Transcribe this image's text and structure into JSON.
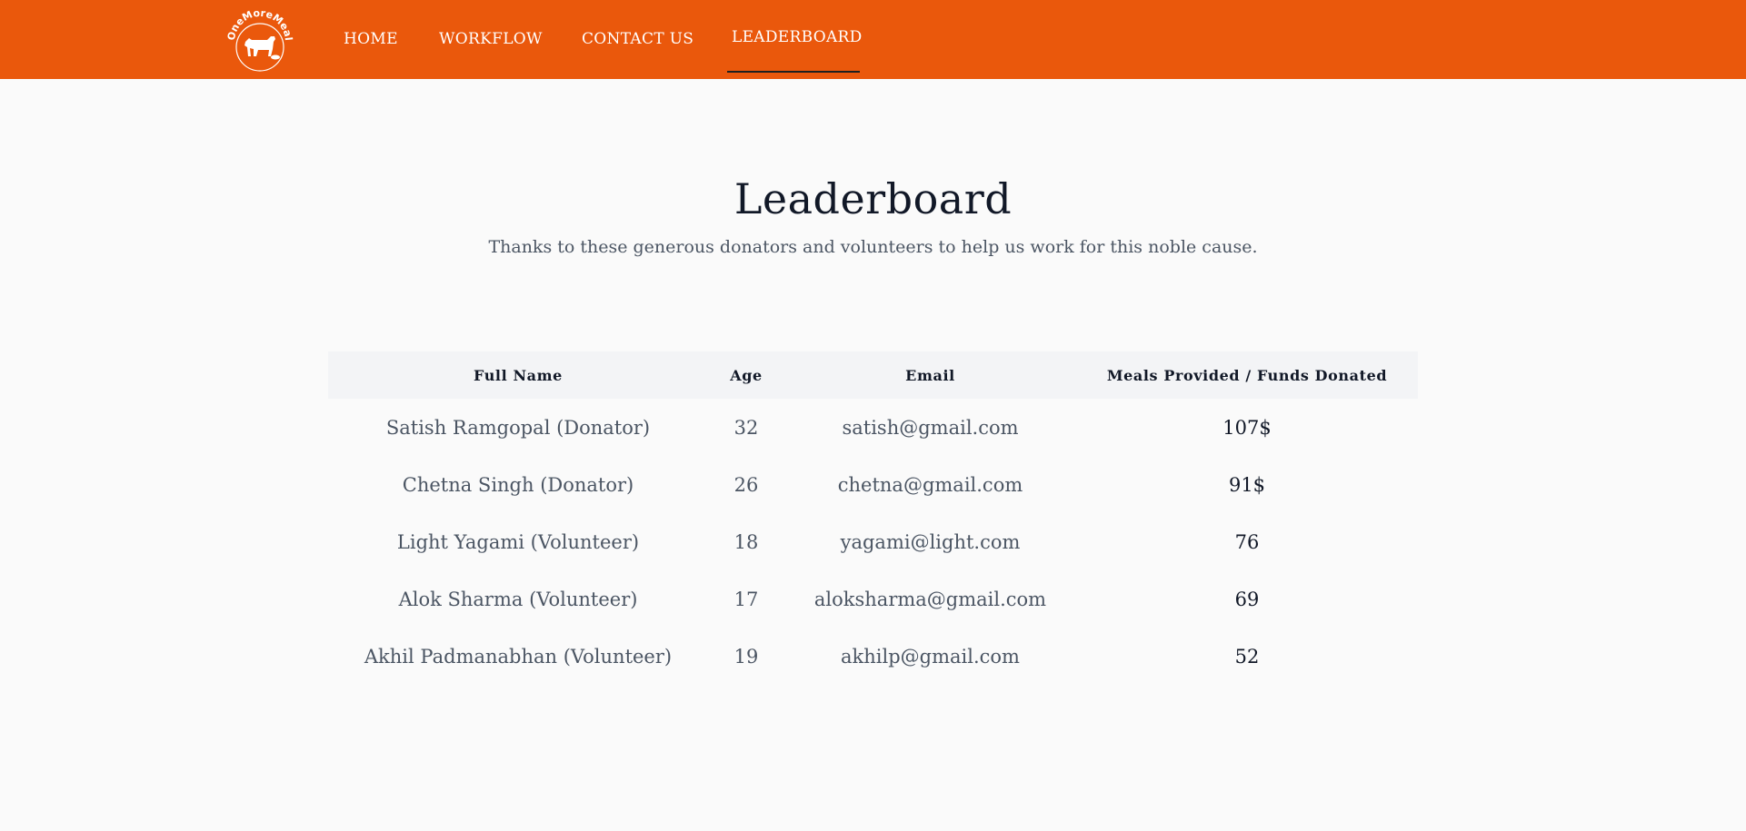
{
  "nav": {
    "logo_alt": "OneMoreMeal",
    "links": [
      {
        "label": "HOME"
      },
      {
        "label": "WORKFLOW"
      },
      {
        "label": "CONTACT US"
      },
      {
        "label": "LEADERBOARD",
        "active": true
      }
    ]
  },
  "header": {
    "title": "Leaderboard",
    "subtitle": "Thanks to these generous donators and volunteers to help us work for this noble cause."
  },
  "table": {
    "columns": [
      "Full Name",
      "Age",
      "Email",
      "Meals Provided / Funds Donated"
    ],
    "rows": [
      {
        "name": "Satish Ramgopal (Donator)",
        "age": "32",
        "email": "satish@gmail.com",
        "meals": "107$"
      },
      {
        "name": "Chetna Singh (Donator)",
        "age": "26",
        "email": "chetna@gmail.com",
        "meals": "91$"
      },
      {
        "name": "Light Yagami (Volunteer)",
        "age": "18",
        "email": "yagami@light.com",
        "meals": "76"
      },
      {
        "name": "Alok Sharma (Volunteer)",
        "age": "17",
        "email": "aloksharma@gmail.com",
        "meals": "69"
      },
      {
        "name": "Akhil Padmanabhan (Volunteer)",
        "age": "19",
        "email": "akhilp@gmail.com",
        "meals": "52"
      }
    ]
  },
  "colors": {
    "brand": "#ea580c",
    "background": "#fafafa",
    "heading": "#111827",
    "muted": "#4b5563",
    "table_header_bg": "#f3f4f6"
  }
}
